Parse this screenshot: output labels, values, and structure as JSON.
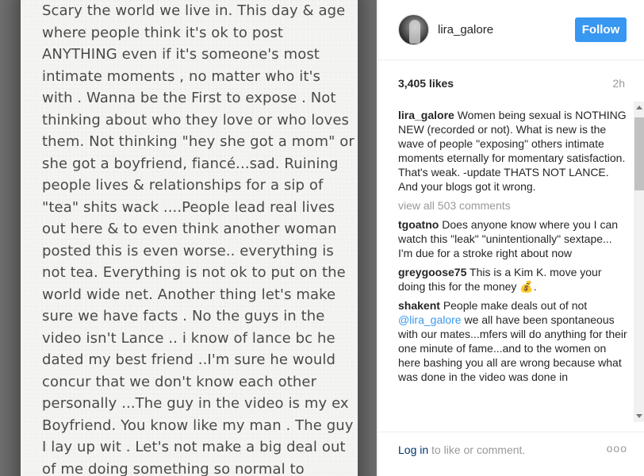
{
  "photo": {
    "lines": [
      "Scary the world we live in. This day & age",
      "where people think it's ok to post",
      "ANYTHING even if it's someone's most",
      "intimate moments , no matter who it's",
      "with . Wanna be the First to expose . Not",
      "thinking about who they love or who loves",
      "them. Not thinking \"hey she got a mom\" or",
      "she got a boyfriend, fiancé...sad. Ruining",
      "people lives & relationships for a sip of",
      "\"tea\" shits wack ....People lead real lives",
      "out here & to even think another woman",
      "posted this is even worse.. everything is",
      "not tea. Everything is not ok to put on the",
      "world wide net. Another thing let's make",
      "sure we have facts . No the guys in the",
      "video isn't Lance .. i know of lance bc he",
      "dated my best friend ..I'm sure he would",
      "concur that we don't know each other",
      "personally ...The guy in the video is my ex",
      "Boyfriend. You know like my man . The guy",
      "I lay up wit . Let's not make a big deal out",
      "of me doing something so normal to"
    ]
  },
  "header": {
    "username": "lira_galore",
    "follow_label": "Follow"
  },
  "meta": {
    "likes": "3,405 likes",
    "time": "2h"
  },
  "caption": {
    "user": "lira_galore",
    "text": "Women being sexual is NOTHING NEW (recorded or not). What is new is the wave of people \"exposing\" others intimate moments eternally for momentary satisfaction. That's weak. -update THATS NOT LANCE. And your blogs got it wrong."
  },
  "view_all": "view all 503 comments",
  "comments": [
    {
      "user": "tgoatno",
      "text": "Does anyone know where you I can watch this \"leak\" \"unintentionally\" sextape... I'm due for a stroke right about now"
    },
    {
      "user": "greygoose75",
      "text": "This is a Kim K. move your doing this for the money 💰."
    },
    {
      "user": "shakent",
      "text_before": "People make deals out of not",
      "mention": "@lira_galore",
      "text_after": "we all have been spontaneous with our mates...mfers will do anything for their one minute of fame...and to the women on here bashing you all are wrong because what was done in the video was done in"
    }
  ],
  "footer": {
    "login_link": "Log in",
    "login_rest": " to like or comment.",
    "more": "ooo"
  },
  "colors": {
    "accent": "#3897f0",
    "muted": "#999999",
    "text": "#262626"
  },
  "icons": {
    "more": "more-options-icon"
  }
}
